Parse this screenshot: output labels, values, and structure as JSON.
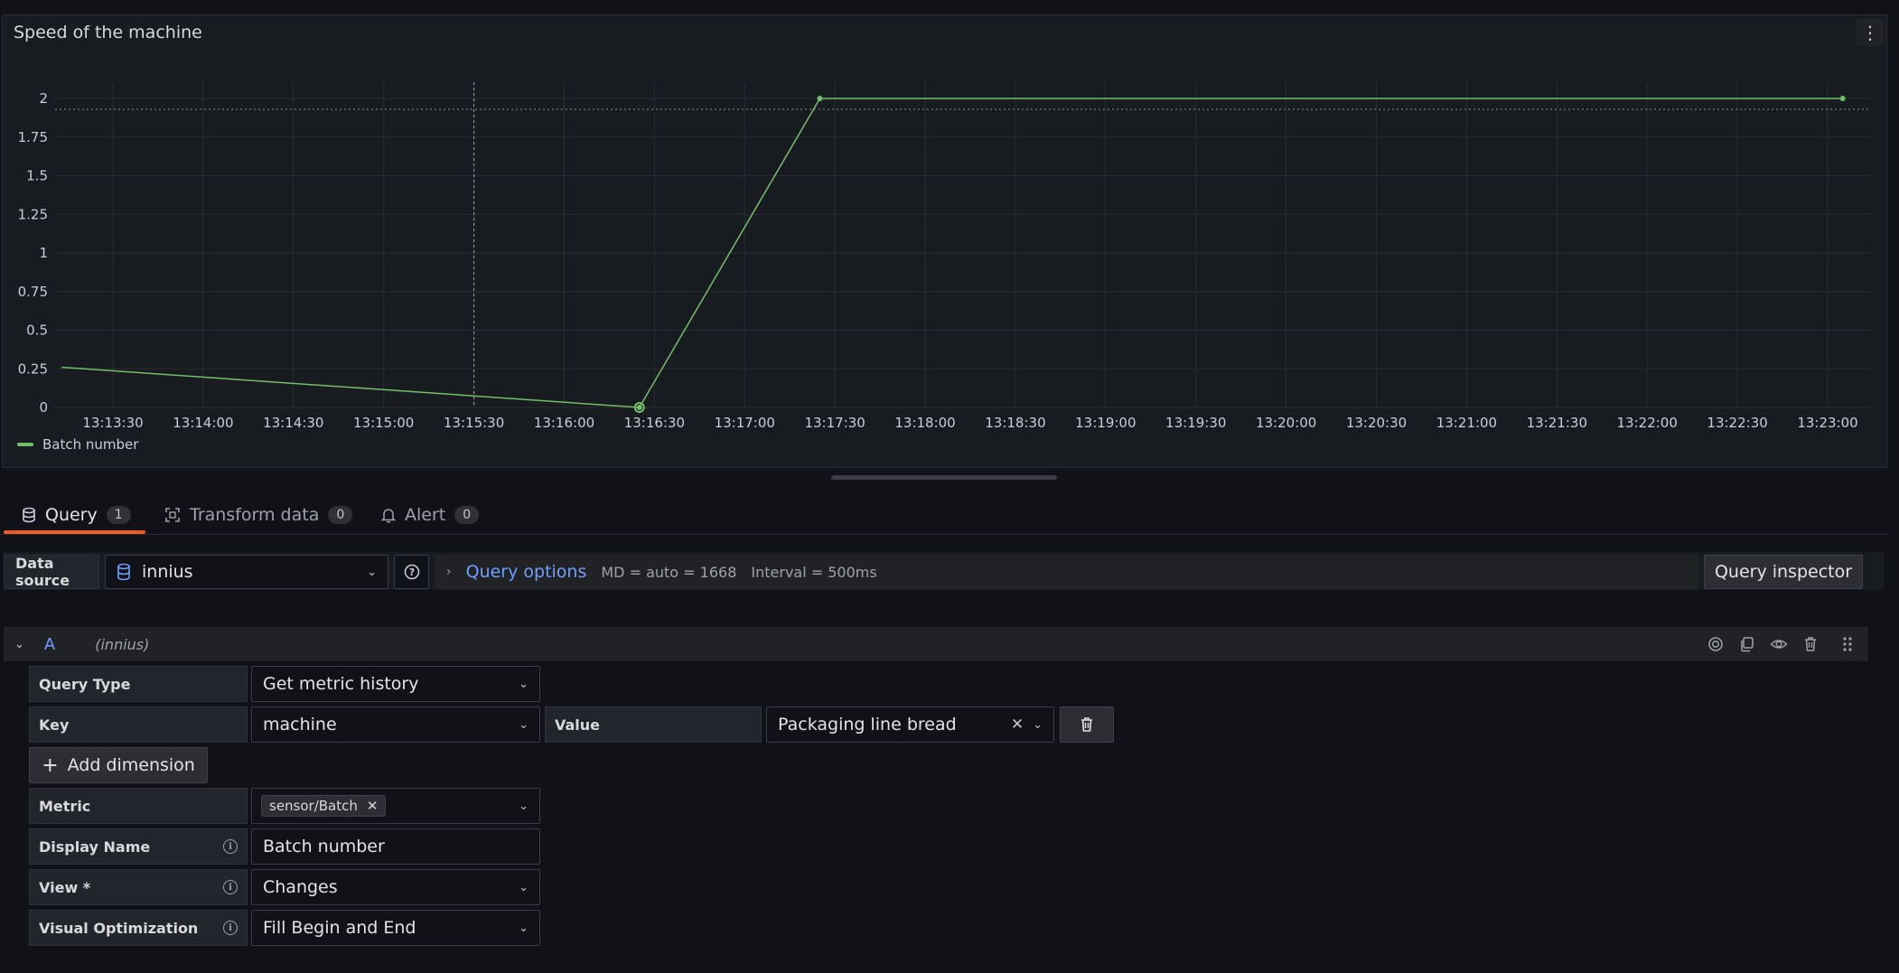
{
  "panel": {
    "title": "Speed of the machine",
    "menu_icon": "kebab-vertical-icon"
  },
  "chart_data": {
    "type": "line",
    "title": "Speed of the machine",
    "y_ticks": [
      "2",
      "1.75",
      "1.5",
      "1.25",
      "1",
      "0.75",
      "0.5",
      "0.25",
      "0"
    ],
    "x_ticks": [
      "13:13:30",
      "13:14:00",
      "13:14:30",
      "13:15:00",
      "13:15:30",
      "13:16:00",
      "13:16:30",
      "13:17:00",
      "13:17:30",
      "13:18:00",
      "13:18:30",
      "13:19:00",
      "13:19:30",
      "13:20:00",
      "13:20:30",
      "13:21:00",
      "13:21:30",
      "13:22:00",
      "13:22:30",
      "13:23:00"
    ],
    "ylim": [
      0,
      2
    ],
    "series": [
      {
        "name": "Batch number",
        "color": "#73bf69",
        "points": [
          {
            "x": "13:13:13",
            "y": 0.26
          },
          {
            "x": "13:16:25",
            "y": 0
          },
          {
            "x": "13:17:25",
            "y": 2
          },
          {
            "x": "13:23:05",
            "y": 2
          }
        ]
      }
    ],
    "threshold": 1.93,
    "cursor_x": "13:15:30",
    "grid": true,
    "legend_position": "bottom-left"
  },
  "legend": {
    "label": "Batch number"
  },
  "tabs": [
    {
      "label": "Query",
      "count": "1",
      "icon": "database-icon"
    },
    {
      "label": "Transform data",
      "count": "0",
      "icon": "transform-icon"
    },
    {
      "label": "Alert",
      "count": "0",
      "icon": "bell-icon"
    }
  ],
  "datasource": {
    "label": "Data source",
    "value": "innius",
    "query_options_label": "Query options",
    "md": "MD = auto = 1668",
    "interval": "Interval = 500ms",
    "inspector_label": "Query inspector"
  },
  "query": {
    "name": "A",
    "datasource": "(innius)",
    "fields": {
      "query_type_label": "Query Type",
      "query_type_value": "Get metric history",
      "key_label": "Key",
      "key_value": "machine",
      "value_label": "Value",
      "value_value": "Packaging line bread",
      "add_dimension_label": "Add dimension",
      "metric_label": "Metric",
      "metric_chip": "sensor/Batch",
      "display_name_label": "Display Name",
      "display_name_value": "Batch number",
      "view_label": "View *",
      "view_value": "Changes",
      "visual_opt_label": "Visual Optimization",
      "visual_opt_value": "Fill Begin and End"
    }
  }
}
